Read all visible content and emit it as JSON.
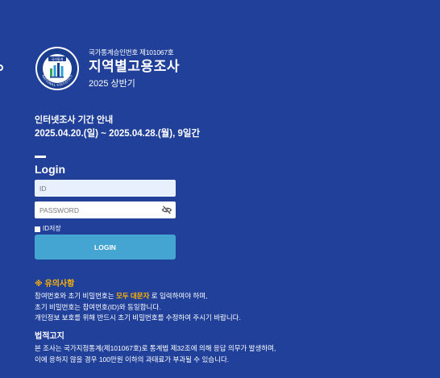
{
  "header": {
    "approval_number": "국가통계승인번호 제101067호",
    "survey_title": "지역별고용조사",
    "survey_period": "2025 상반기",
    "logo": {
      "name": "statistics-korea-seal",
      "top_text": "국가통계",
      "bottom_text": "NATIONAL STATISTICS"
    }
  },
  "notice": {
    "title": "인터넷조사 기간 안내",
    "dates": "2025.04.20.(일) ~ 2025.04.28.(월), 9일간"
  },
  "login": {
    "heading": "Login",
    "id_placeholder": "ID",
    "id_value": "",
    "password_placeholder": "PASSWORD",
    "password_value": "",
    "password_toggle_icon": "eye-slash-icon",
    "remember_label": "ID저장",
    "remember_checked": false,
    "button_label": "LOGIN"
  },
  "caution": {
    "title": "※ 유의사항",
    "line1_before": "참여번호와 초기 비밀번호는 ",
    "line1_highlight": "모두 대문자",
    "line1_after": " 로 입력하여야 하며,",
    "line2": "초기 비밀번호는 참여번호(ID)와 동일합니다.",
    "line3": "개인정보 보호를 위해 반드시 초기 비밀번호를 수정하여 주시기 바랍니다."
  },
  "legal": {
    "title": "법적고지",
    "line1": "본 조사는 국가지정통계(제101067호)로 통계법 제32조에 의해 응답 의무가 발생하며,",
    "line2": "이에 응하지 않을 경우 100만원 이하의 과태료가 부과될 수 있습니다."
  },
  "colors": {
    "background": "#20409a",
    "accent": "#ffb300",
    "login_button": "#44a4d2",
    "id_field": "#e8f0fe"
  }
}
